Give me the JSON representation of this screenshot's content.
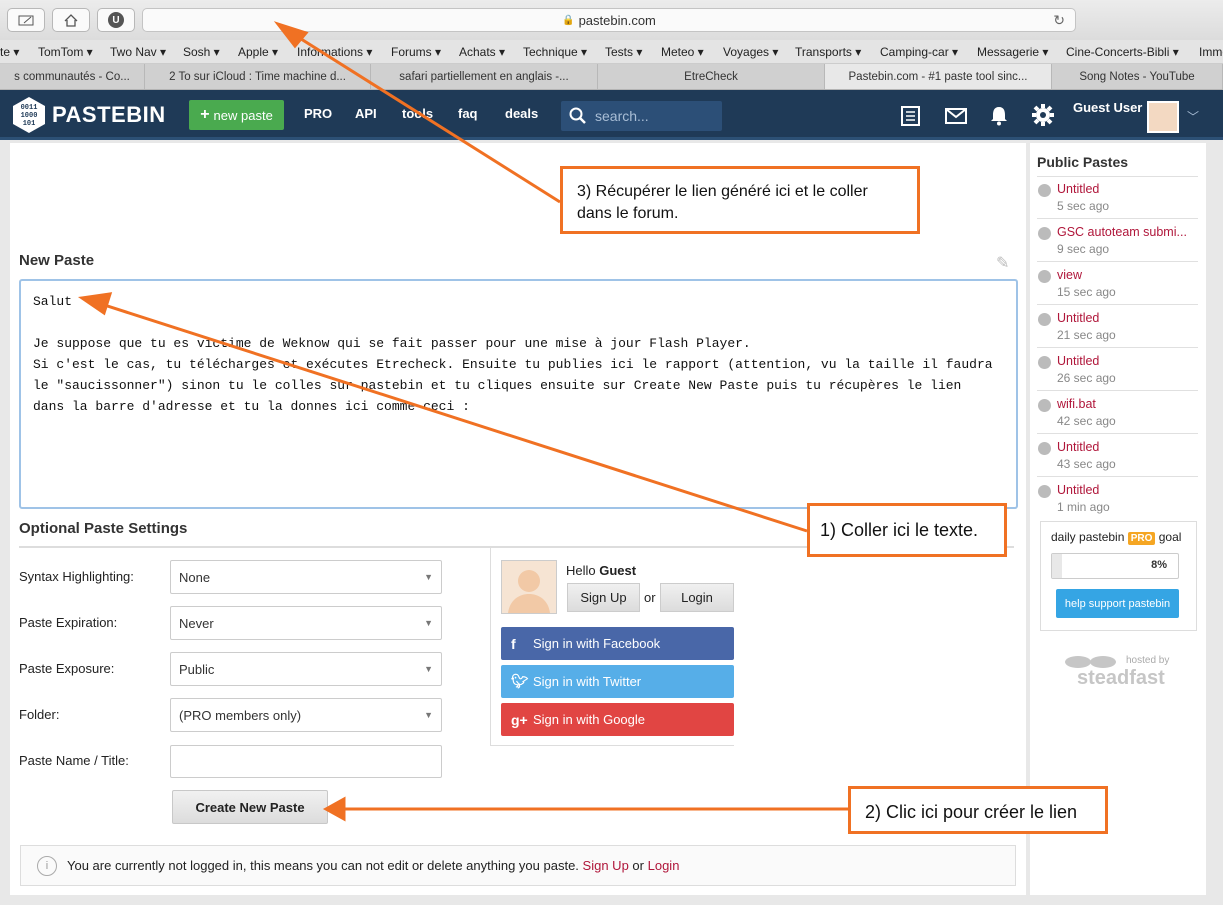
{
  "browser": {
    "url": "pastebin.com",
    "bookmarks": [
      "te ▾",
      "TomTom ▾",
      "Two Nav ▾",
      "Sosh ▾",
      "Apple ▾",
      "Informations ▾",
      "Forums ▾",
      "Achats ▾",
      "Technique ▾",
      "Tests ▾",
      "Meteo ▾",
      "Voyages ▾",
      "Transports ▾",
      "Camping-car ▾",
      "Messagerie ▾",
      "Cine-Concerts-Bibli ▾",
      "Imme"
    ],
    "tabs": [
      "s communautés - Co...",
      "2 To sur iCloud : Time machine d...",
      "safari partiellement en anglais -...",
      "EtreCheck",
      "Pastebin.com - #1 paste tool sinc...",
      "Song Notes - YouTube"
    ]
  },
  "header": {
    "logo_text": "PASTEBIN",
    "new_paste": "new paste",
    "nav": [
      "PRO",
      "API",
      "tools",
      "faq",
      "deals"
    ],
    "search_placeholder": "search...",
    "user": "Guest User"
  },
  "new_paste": {
    "heading": "New Paste",
    "text": "Salut\n\nJe suppose que tu es victime de Weknow qui se fait passer pour une mise à jour Flash Player.\nSi c'est le cas, tu télécharges et exécutes Etrecheck. Ensuite tu publies ici le rapport (attention, vu la taille il faudra\nle \"saucissonner\") sinon tu le colles sur pastebin et tu cliques ensuite sur Create New Paste puis tu récupères le lien\ndans la barre d'adresse et tu la donnes ici comme ceci :"
  },
  "settings": {
    "heading": "Optional Paste Settings",
    "syntax_label": "Syntax Highlighting:",
    "syntax_value": "None",
    "expiration_label": "Paste Expiration:",
    "expiration_value": "Never",
    "exposure_label": "Paste Exposure:",
    "exposure_value": "Public",
    "folder_label": "Folder:",
    "folder_value": "(PRO members only)",
    "name_label": "Paste Name / Title:",
    "create_button": "Create New Paste"
  },
  "login": {
    "hello": "Hello",
    "guest": "Guest",
    "signup": "Sign Up",
    "or": "or",
    "login": "Login",
    "facebook": "Sign in with Facebook",
    "twitter": "Sign in with Twitter",
    "google": "Sign in with Google",
    "colors": {
      "facebook": "#4967a8",
      "twitter": "#56aee8",
      "google": "#e14543"
    }
  },
  "notice": {
    "text": "You are currently not logged in, this means you can not edit or delete anything you paste.",
    "signup": "Sign Up",
    "or": "or",
    "login": "Login"
  },
  "sidebar": {
    "title": "Public Pastes",
    "items": [
      {
        "name": "Untitled",
        "time": "5 sec ago"
      },
      {
        "name": "GSC autoteam submi...",
        "time": "9 sec ago"
      },
      {
        "name": "view",
        "time": "15 sec ago"
      },
      {
        "name": "Untitled",
        "time": "21 sec ago"
      },
      {
        "name": "Untitled",
        "time": "26 sec ago"
      },
      {
        "name": "wifi.bat",
        "time": "42 sec ago"
      },
      {
        "name": "Untitled",
        "time": "43 sec ago"
      },
      {
        "name": "Untitled",
        "time": "1 min ago"
      }
    ],
    "goal_title": "daily pastebin",
    "goal_pro": "PRO",
    "goal_word": "goal",
    "goal_percent": "8%",
    "goal_fraction": 0.08,
    "support": "help support pastebin",
    "hosted_by": "hosted by",
    "host": "steadfast"
  },
  "annotations": {
    "step3": "3)  Récupérer le lien généré  ici et le coller dans le forum.",
    "step1": "1) Coller ici le texte.",
    "step2": "2)  Clic ici pour créer le lien",
    "arrow_color": "#f07123"
  }
}
